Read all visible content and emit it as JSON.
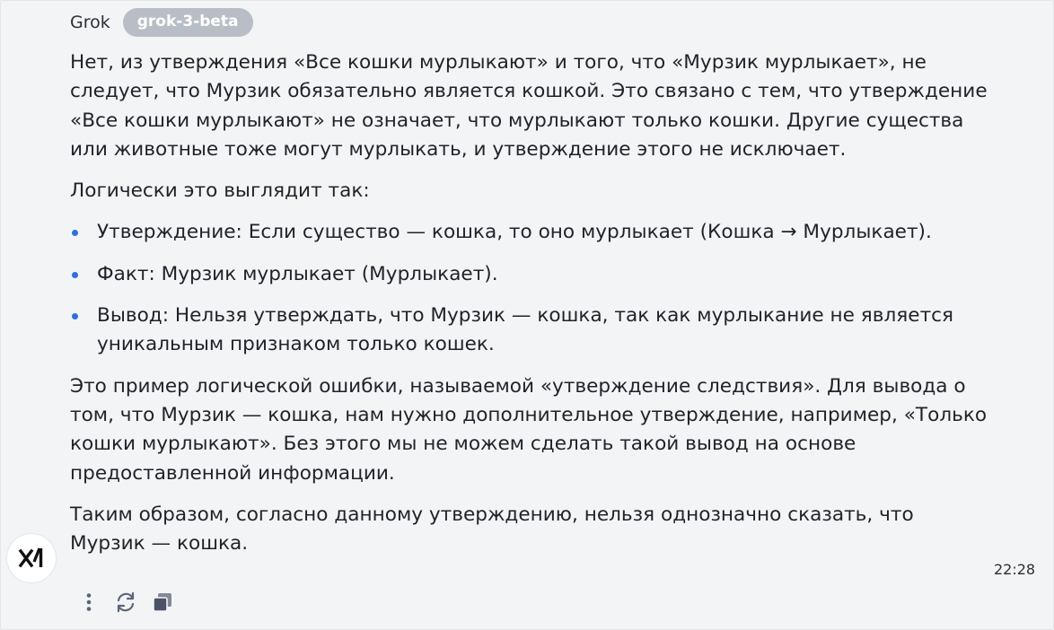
{
  "header": {
    "sender": "Grok",
    "model": "grok-3-beta"
  },
  "message": {
    "paragraphs_before": [
      "Нет, из утверждения «Все кошки мурлыкают» и того, что «Мурзик мурлыкает», не следует, что Мурзик обязательно является кошкой. Это связано с тем, что утверждение «Все кошки мурлыкают» не означает, что мурлыкают только кошки. Другие существа или животные тоже могут мурлыкать, и утверждение этого не исключает.",
      "Логически это выглядит так:"
    ],
    "bullets": [
      "Утверждение: Если существо — кошка, то оно мурлыкает (Кошка → Мурлыкает).",
      "Факт: Мурзик мурлыкает (Мурлыкает).",
      "Вывод: Нельзя утверждать, что Мурзик — кошка, так как мурлыкание не является уникальным признаком только кошек."
    ],
    "paragraphs_after": [
      "Это пример логической ошибки, называемой «утверждение следствия». Для вывода о том, что Мурзик — кошка, нам нужно дополнительное утверждение, например, «Только кошки мурлыкают». Без этого мы не можем сделать такой вывод на основе предоставленной информации.",
      "Таким образом, согласно данному утверждению, нельзя однозначно сказать, что Мурзик — кошка."
    ],
    "timestamp": "22:28"
  },
  "avatar": {
    "icon": "xai-logo-icon"
  },
  "actions": [
    {
      "icon": "more-vertical-icon"
    },
    {
      "icon": "regenerate-icon"
    },
    {
      "icon": "copy-icon"
    }
  ],
  "colors": {
    "background": "#f3f4f6",
    "badge": "#b8bec6",
    "bullet": "#2f6fe0",
    "text": "#1f2329",
    "icon": "#5b6577"
  }
}
